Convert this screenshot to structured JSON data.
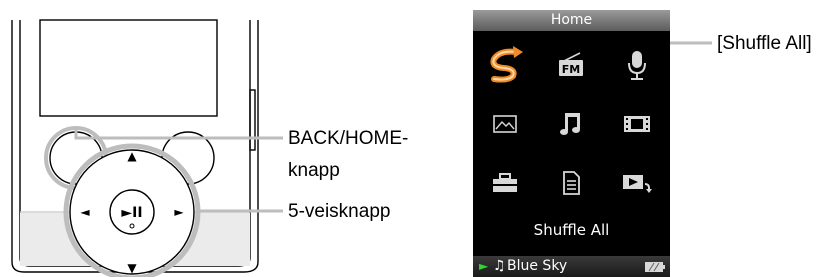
{
  "callouts": {
    "back_home_line1": "BACK/HOME-",
    "back_home_line2": "knapp",
    "five_way": "5-veisknapp",
    "shuffle_all": "[Shuffle All]"
  },
  "screen": {
    "title": "Home",
    "selected_label": "Shuffle All",
    "status": {
      "playing_track": "Blue Sky",
      "play_glyph": "►",
      "note_glyph": "♫"
    },
    "icons": [
      {
        "name": "shuffle-all-icon",
        "selected": true
      },
      {
        "name": "fm-radio-icon",
        "text": "FM"
      },
      {
        "name": "microphone-icon"
      },
      {
        "name": "photo-icon"
      },
      {
        "name": "music-icon"
      },
      {
        "name": "video-icon"
      },
      {
        "name": "settings-toolbox-icon"
      },
      {
        "name": "document-icon"
      },
      {
        "name": "now-playing-icon"
      }
    ],
    "colors": {
      "selected_icon": "#f08a24",
      "icon": "#d8d8d8",
      "play_indicator": "#2fd62f"
    }
  },
  "device": {
    "glyphs": {
      "up": "▲",
      "down": "▼",
      "left": "◄",
      "right": "►",
      "center": "►II"
    }
  }
}
